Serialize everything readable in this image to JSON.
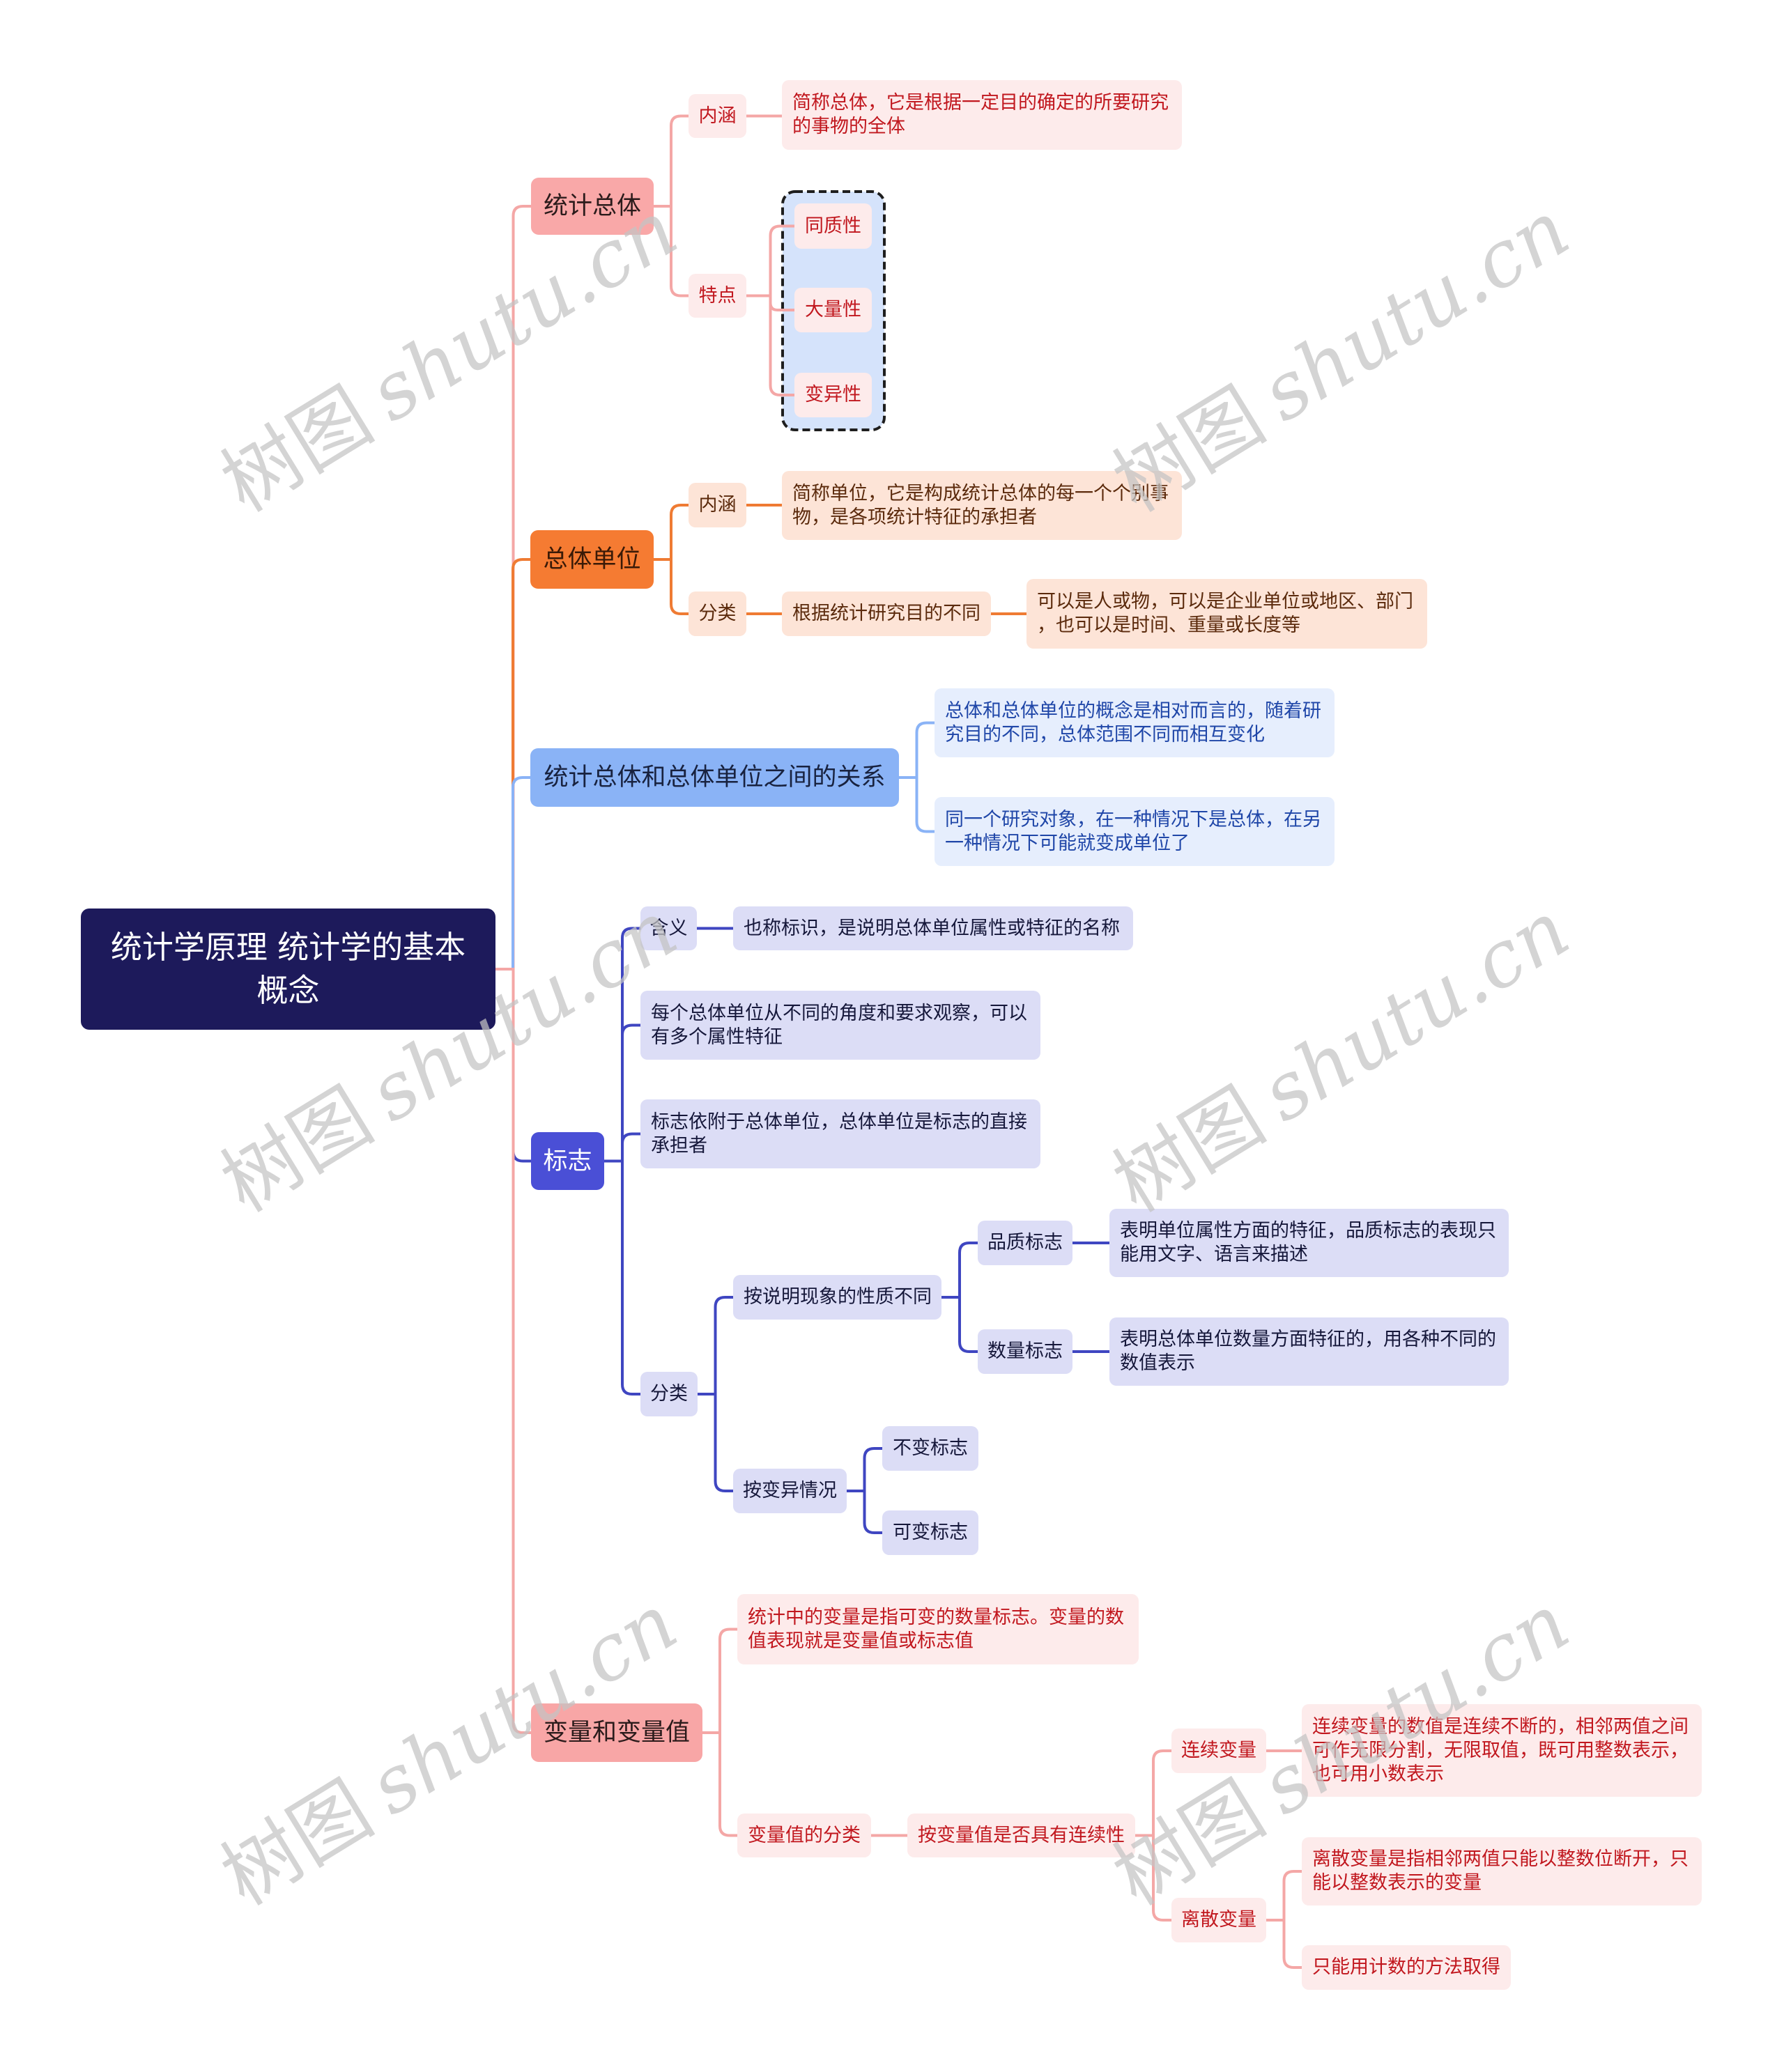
{
  "watermark": {
    "cn": "树图",
    "en": "shutu.cn"
  },
  "theme": {
    "root": {
      "bg": "#1D1A5B",
      "text": "#FFFFFF"
    },
    "branches": [
      {
        "node_bg": "#F9A8A8",
        "node_text": "#2B1B1B",
        "line": "#F4A7A6",
        "child_bg": "#FDEBEB",
        "child_text": "#C1171E"
      },
      {
        "node_bg": "#F57B32",
        "node_text": "#3A1A07",
        "line": "#EF7B33",
        "child_bg": "#FDE4D7",
        "child_text": "#5B2A0C"
      },
      {
        "node_bg": "#8AB3F6",
        "node_text": "#18223F",
        "line": "#8AB3F6",
        "child_bg": "#E6EEFD",
        "child_text": "#1F46A8"
      },
      {
        "node_bg": "#4A4FD6",
        "node_text": "#FFFFFF",
        "line": "#3F46C1",
        "child_bg": "#DCDDF6",
        "child_text": "#15173A"
      },
      {
        "node_bg": "#F8A6A6",
        "node_text": "#2B1B1B",
        "line": "#F4A7A6",
        "child_bg": "#FDEBEB",
        "child_text": "#C1171E"
      }
    ],
    "group_box": {
      "bg": "#D5E3FB",
      "border": "#1E1E1E"
    },
    "watermark": "#C4C4C4"
  },
  "root": {
    "title": "统计学原理 统计学的基本\n概念"
  },
  "branches": [
    {
      "label": "统计总体",
      "children": [
        {
          "label": "内涵",
          "children": [
            {
              "label": "简称总体，它是根据一定目的确定的所要研究\n的事物的全体"
            }
          ]
        },
        {
          "label": "特点",
          "grouped": true,
          "children": [
            {
              "label": "同质性"
            },
            {
              "label": "大量性"
            },
            {
              "label": "变异性"
            }
          ]
        }
      ]
    },
    {
      "label": "总体单位",
      "children": [
        {
          "label": "内涵",
          "children": [
            {
              "label": "简称单位，它是构成统计总体的每一个个别事\n物，是各项统计特征的承担者"
            }
          ]
        },
        {
          "label": "分类",
          "children": [
            {
              "label": "根据统计研究目的不同",
              "children": [
                {
                  "label": "可以是人或物，可以是企业单位或地区、部门\n，也可以是时间、重量或长度等"
                }
              ]
            }
          ]
        }
      ]
    },
    {
      "label": "统计总体和总体单位之间的关系",
      "children": [
        {
          "label": "总体和总体单位的概念是相对而言的，随着研\n究目的不同，总体范围不同而相互变化"
        },
        {
          "label": "同一个研究对象，在一种情况下是总体，在另\n一种情况下可能就变成单位了"
        }
      ]
    },
    {
      "label": "标志",
      "children": [
        {
          "label": "含义",
          "children": [
            {
              "label": "也称标识，是说明总体单位属性或特征的名称"
            }
          ]
        },
        {
          "label": "每个总体单位从不同的角度和要求观察，可以\n有多个属性特征"
        },
        {
          "label": "标志依附于总体单位，总体单位是标志的直接\n承担者"
        },
        {
          "label": "分类",
          "children": [
            {
              "label": "按说明现象的性质不同",
              "children": [
                {
                  "label": "品质标志",
                  "children": [
                    {
                      "label": "表明单位属性方面的特征，品质标志的表现只\n能用文字、语言来描述"
                    }
                  ]
                },
                {
                  "label": "数量标志",
                  "children": [
                    {
                      "label": "表明总体单位数量方面特征的，用各种不同的\n数值表示"
                    }
                  ]
                }
              ]
            },
            {
              "label": "按变异情况",
              "children": [
                {
                  "label": "不变标志"
                },
                {
                  "label": "可变标志"
                }
              ]
            }
          ]
        }
      ]
    },
    {
      "label": "变量和变量值",
      "children": [
        {
          "label": "统计中的变量是指可变的数量标志。变量的数\n值表现就是变量值或标志值"
        },
        {
          "label": "变量值的分类",
          "children": [
            {
              "label": "按变量值是否具有连续性",
              "children": [
                {
                  "label": "连续变量",
                  "children": [
                    {
                      "label": "连续变量的数值是连续不断的，相邻两值之间\n可作无限分割，无限取值，既可用整数表示，\n也可用小数表示"
                    }
                  ]
                },
                {
                  "label": "离散变量",
                  "children": [
                    {
                      "label": "离散变量是指相邻两值只能以整数位断开，只\n能以整数表示的变量"
                    },
                    {
                      "label": "只能用计数的方法取得"
                    }
                  ]
                }
              ]
            }
          ]
        }
      ]
    }
  ]
}
